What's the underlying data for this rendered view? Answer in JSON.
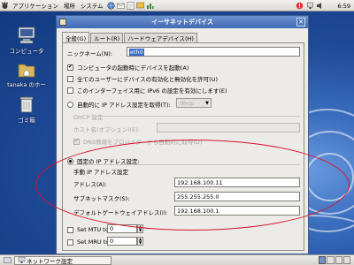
{
  "top_panel": {
    "menus": [
      "アプリケーション",
      "場所",
      "システム"
    ],
    "clock": "6:59"
  },
  "desktop": {
    "icons": [
      {
        "label": "コンピュータ",
        "icon": "computer-icon"
      },
      {
        "label": "tanaka のホー",
        "icon": "home-folder-icon"
      },
      {
        "label": "ゴミ箱",
        "icon": "trash-icon"
      }
    ]
  },
  "dialog": {
    "title": "イーサネットデバイス",
    "tabs": [
      "全般(G)",
      "ルート(R)",
      "ハードウェアデバイス(H)"
    ],
    "nickname_label": "ニックネーム(N):",
    "nickname_value": "eth0",
    "checkboxes": [
      {
        "label": "コンピュータの起動時にデバイスを起動(A)",
        "checked": true
      },
      {
        "label": "全てのユーザーにデバイスの有効化と無効化を許可(U)",
        "checked": false
      },
      {
        "label": "このインターフェイス用に IPv6 の設定を有効にします(E)",
        "checked": false
      }
    ],
    "auto_ip_label": "自動的に IP アドレス設定を取得(T):",
    "auto_ip_method": "dhcp",
    "dhcp_section_label": "DHCP 設定",
    "hostname_label": "ホスト名(オプション)(E):",
    "dns_auto_label": "DNS情報をプロバイダーから自動的に取得(D)",
    "static_label": "固定の IP アドレス設定:",
    "manual_section_label": "手動 IP アドレス設定",
    "address_label": "アドレス(A):",
    "address_value": "192.168.100.11",
    "subnet_label": "サブネットマスク(S):",
    "subnet_value": "255.255.255.0",
    "gateway_label": "デフォルトゲートウェイアドレス(I):",
    "gateway_value": "192.168.100.1",
    "mtu_label": "Set MTU to:",
    "mtu_value": "0",
    "mru_label": "Set MRU to:",
    "mru_value": "0"
  },
  "taskbar": {
    "task_label": "ネットワーク設定"
  },
  "colors": {
    "titlebar": "#3e68b2",
    "annotation": "#d8102a"
  }
}
